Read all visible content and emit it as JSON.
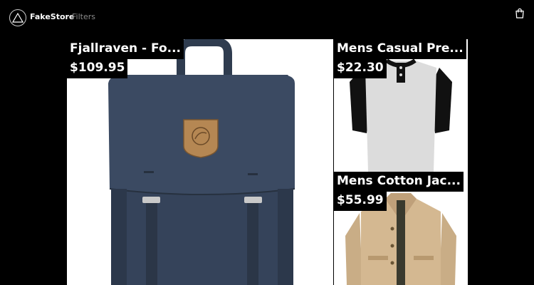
{
  "header": {
    "brand": "FakeStore",
    "nav": {
      "filters_label": "Filters"
    },
    "icons": {
      "logo": "triangle-logo-icon",
      "cart": "shopping-bag-icon"
    }
  },
  "products": [
    {
      "title": "Fjallraven - Fo...",
      "price": "$109.95",
      "image": "navy-backpack"
    },
    {
      "title": "Mens Casual Pre...",
      "price": "$22.30",
      "image": "raglan-henley-shirt"
    },
    {
      "title": "Mens Cotton Jac...",
      "price": "$55.99",
      "image": "beige-cotton-jacket"
    }
  ]
}
